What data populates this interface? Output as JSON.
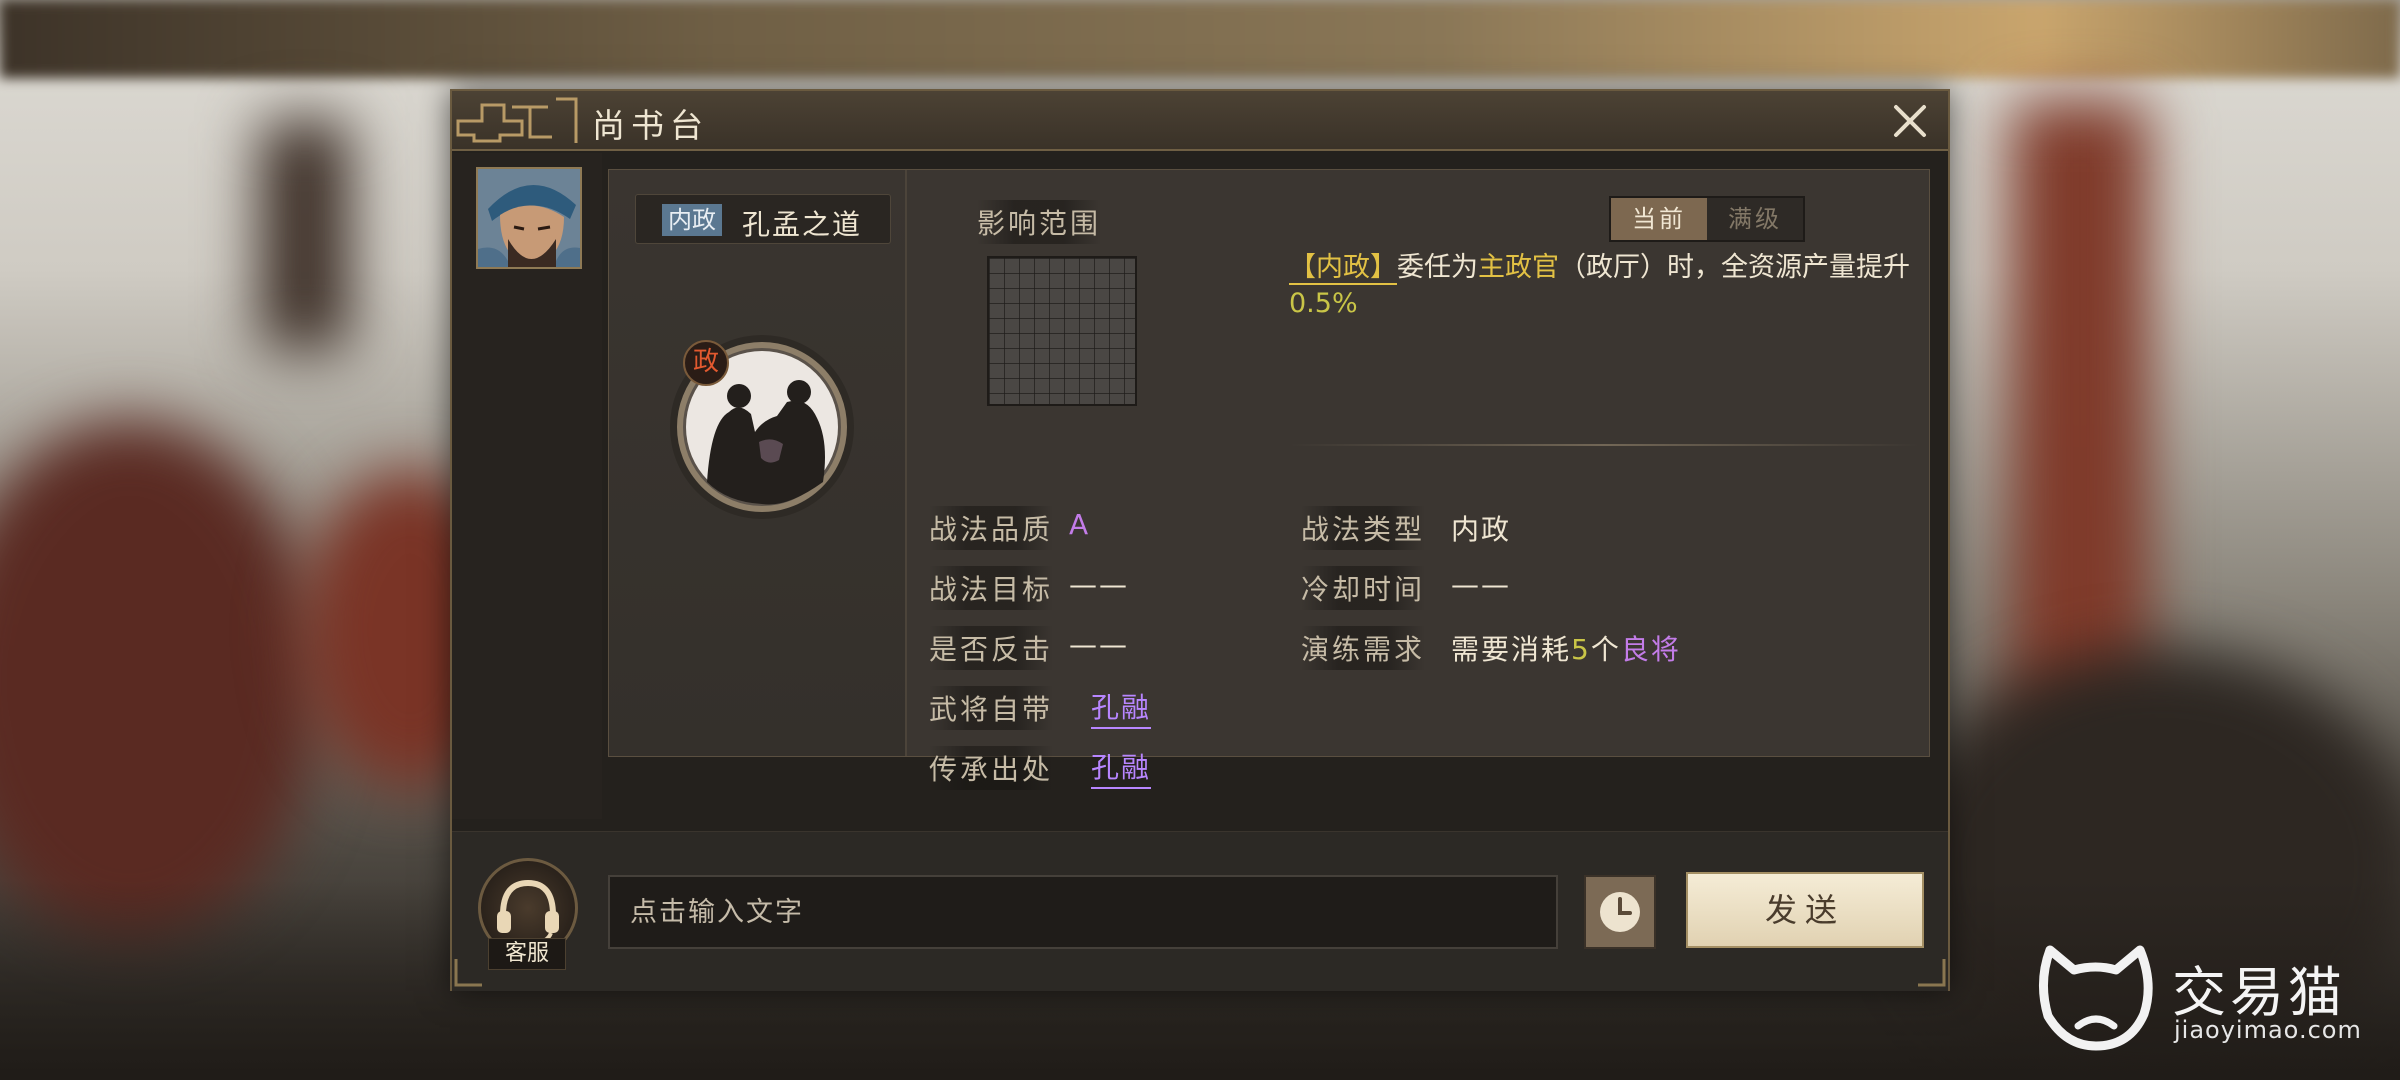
{
  "dialog": {
    "title": "尚书台"
  },
  "skill": {
    "type_tag": "内政",
    "name": "孔孟之道",
    "icon_badge": "政"
  },
  "info": {
    "range_label": "影响范围",
    "toggle": {
      "current": "当前",
      "max": "满级"
    },
    "description": {
      "tag": "【内政】",
      "text1": "委任为",
      "highlight": "主政官",
      "text2": "（政厅）时，全资源产量提升",
      "value": "0.5%"
    },
    "left_rows": [
      {
        "label": "战法品质",
        "value": "A"
      },
      {
        "label": "战法目标",
        "value": "——"
      },
      {
        "label": "是否反击",
        "value": "——"
      },
      {
        "label": "武将自带",
        "value": "孔融"
      },
      {
        "label": "传承出处",
        "value": "孔融"
      }
    ],
    "right_rows": [
      {
        "label": "战法类型",
        "value": "内政"
      },
      {
        "label": "冷却时间",
        "value": "——"
      }
    ],
    "training": {
      "label": "演练需求",
      "prefix": "需要消耗",
      "count": "5",
      "unit": "个",
      "item": "良将"
    }
  },
  "input_bar": {
    "service_label": "客服",
    "input_placeholder": "点击输入文字",
    "send_label": "发送"
  },
  "watermark": {
    "name": "交易猫",
    "domain": "jiaoyimao.com"
  },
  "colors": {
    "accent_gold": "#e2c144",
    "quality_purple": "#c37ce8",
    "link_purple": "#b886ff",
    "panel_bg": "#3b3631"
  }
}
